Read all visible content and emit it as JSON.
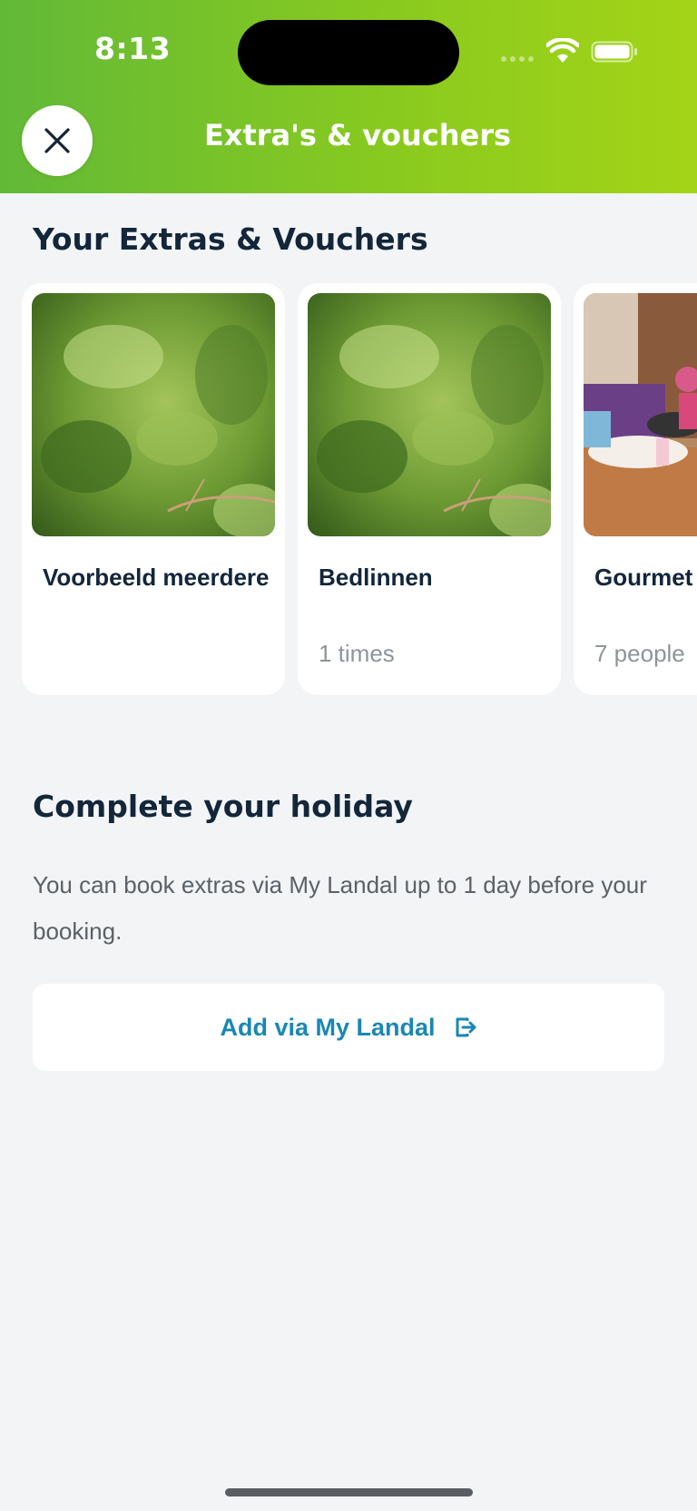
{
  "status_bar": {
    "time": "8:13",
    "icons": [
      "cellular-signal-icon",
      "wifi-icon",
      "battery-icon"
    ]
  },
  "header": {
    "title": "Extra's & vouchers",
    "close_icon": "close-icon",
    "gradient_colors": [
      "#62b937",
      "#a4d417"
    ]
  },
  "extras": {
    "title": "Your Extras & Vouchers",
    "items": [
      {
        "name": "Voorbeeld meerdere",
        "detail": "",
        "image": "green-leaves-photo"
      },
      {
        "name": "Bedlinnen",
        "detail": "1 times",
        "image": "green-leaves-photo"
      },
      {
        "name": "Gourmet",
        "detail": "7 people",
        "image": "dining-table-photo"
      }
    ]
  },
  "holiday": {
    "title": "Complete your holiday",
    "description": "You can book extras via My Landal up to 1 day before your booking.",
    "button_label": "Add via My Landal",
    "button_icon": "external-link-icon",
    "accent_color": "#1a87b4"
  }
}
